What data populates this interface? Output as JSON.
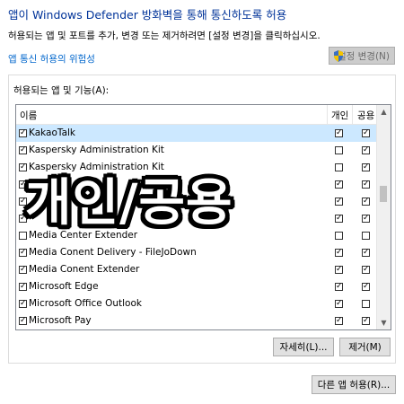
{
  "header": {
    "title": "앱이 Windows Defender 방화벽을 통해 통신하도록 허용",
    "subtitle": "허용되는 앱 및 포트를 추가, 변경 또는 제거하려면 [설정 변경]을 클릭하십시오.",
    "risk_link": "앱 통신 허용의 위험성",
    "change_settings": "설정 변경(N)"
  },
  "group": {
    "label": "허용되는 앱 및 기능(A):"
  },
  "table": {
    "col_name": "이름",
    "col_private": "개인",
    "col_public": "공용",
    "rows": [
      {
        "name": "KakaoTalk",
        "checked": true,
        "private": true,
        "public": true,
        "selected": true
      },
      {
        "name": "Kaspersky Administration Kit",
        "checked": true,
        "private": false,
        "public": true
      },
      {
        "name": "Kaspersky Administration Kit",
        "checked": true,
        "private": false,
        "public": true
      },
      {
        "name": "",
        "checked": true,
        "private": true,
        "public": true
      },
      {
        "name": "",
        "checked": true,
        "private": true,
        "public": true
      },
      {
        "name": "",
        "checked": true,
        "private": true,
        "public": true
      },
      {
        "name": "Media Center Extender",
        "checked": false,
        "private": false,
        "public": false
      },
      {
        "name": "Media Conent Delivery - FileJoDown",
        "checked": true,
        "private": true,
        "public": true
      },
      {
        "name": "Media Conent Extender",
        "checked": true,
        "private": true,
        "public": true
      },
      {
        "name": "Microsoft Edge",
        "checked": true,
        "private": true,
        "public": true
      },
      {
        "name": "Microsoft Office Outlook",
        "checked": true,
        "private": true,
        "public": false
      },
      {
        "name": "Microsoft Pay",
        "checked": true,
        "private": true,
        "public": true
      }
    ]
  },
  "buttons": {
    "details": "자세히(L)...",
    "remove": "제거(M)",
    "allow_other": "다른 앱 허용(R)..."
  },
  "overlay": {
    "text": "개인/공용"
  },
  "colors": {
    "title": "#003399",
    "link": "#0066cc",
    "selected_row": "#cce8ff"
  }
}
